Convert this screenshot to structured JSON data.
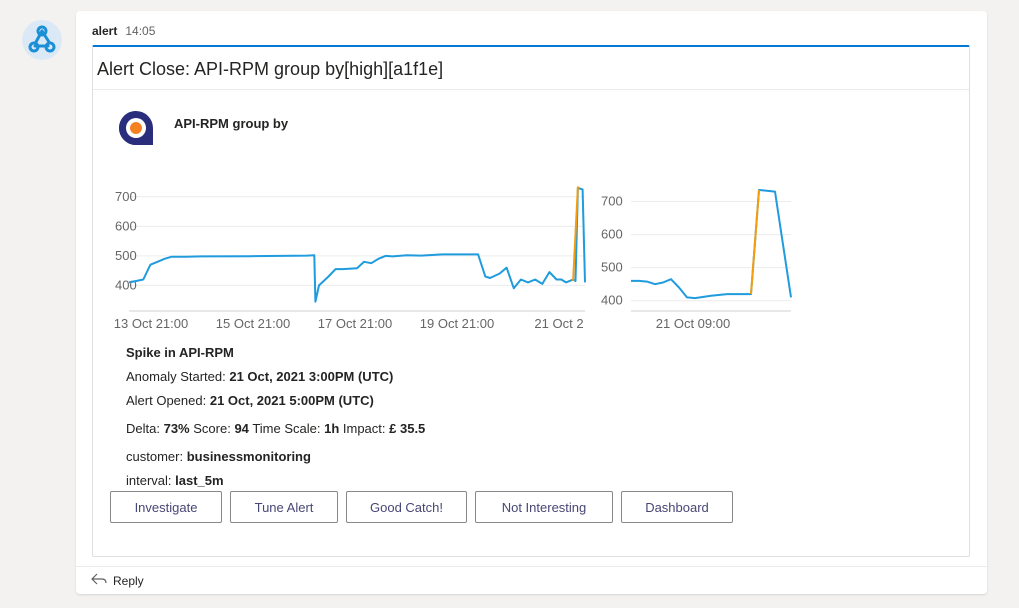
{
  "message": {
    "sender": "alert",
    "time": "14:05",
    "bot_icon": "webhook-icon"
  },
  "card": {
    "title": "Alert Close: API-RPM group by[high][a1f1e]",
    "logo_icon": "anodot-logo-icon",
    "subject": "API-RPM group by",
    "accent_color": "#0078d4"
  },
  "chart_data": [
    {
      "type": "line",
      "title": "",
      "y_ticks": [
        "700",
        "600",
        "500",
        "400"
      ],
      "x_ticks": [
        "13 Oct 21:00",
        "15 Oct 21:00",
        "17 Oct 21:00",
        "19 Oct 21:00",
        "21 Oct 2"
      ],
      "ylim": [
        320,
        740
      ],
      "series": [
        {
          "color": "#1f9bde",
          "x": [
            "2021-10-13T18:00",
            "2021-10-13T21:00",
            "2021-10-14T00:00",
            "2021-10-14T03:00",
            "2021-10-14T06:00",
            "2021-10-14T09:00",
            "2021-10-14T12:00",
            "2021-10-14T18:00",
            "2021-10-15T00:00",
            "2021-10-15T21:00",
            "2021-10-16T21:00",
            "2021-10-17T00:00",
            "2021-10-17T00:30",
            "2021-10-17T02:00",
            "2021-10-17T06:00",
            "2021-10-17T09:00",
            "2021-10-17T12:00",
            "2021-10-17T18:00",
            "2021-10-17T21:00",
            "2021-10-18T00:00",
            "2021-10-18T03:00",
            "2021-10-18T06:00",
            "2021-10-18T09:00",
            "2021-10-18T15:00",
            "2021-10-18T21:00",
            "2021-10-19T06:00",
            "2021-10-19T21:00",
            "2021-10-20T00:00",
            "2021-10-20T02:00",
            "2021-10-20T06:00",
            "2021-10-20T09:00",
            "2021-10-20T12:00",
            "2021-10-20T15:00",
            "2021-10-20T18:00",
            "2021-10-20T21:00",
            "2021-10-21T00:00",
            "2021-10-21T03:00",
            "2021-10-21T06:00",
            "2021-10-21T08:00",
            "2021-10-21T10:00",
            "2021-10-21T13:00",
            "2021-10-21T14:00",
            "2021-10-21T15:00",
            "2021-10-21T17:00",
            "2021-10-21T18:00"
          ],
          "values": [
            410,
            415,
            420,
            470,
            480,
            490,
            497,
            497,
            498,
            499,
            501,
            502,
            345,
            400,
            430,
            455,
            455,
            458,
            480,
            475,
            490,
            500,
            498,
            502,
            501,
            505,
            505,
            430,
            425,
            440,
            460,
            390,
            420,
            410,
            420,
            405,
            445,
            420,
            420,
            410,
            420,
            415,
            730,
            725,
            410
          ]
        },
        {
          "color": "#f59d0c",
          "x": [
            "2021-10-21T13:00",
            "2021-10-21T15:00"
          ],
          "values": [
            415,
            735
          ]
        }
      ]
    },
    {
      "type": "line",
      "title": "",
      "y_ticks": [
        "700",
        "600",
        "500",
        "400"
      ],
      "x_ticks": [
        "21 Oct 09:00"
      ],
      "ylim": [
        375,
        750
      ],
      "series": [
        {
          "color": "#1f9bde",
          "x": [
            "2021-10-21T07:00",
            "2021-10-21T07:30",
            "2021-10-21T08:00",
            "2021-10-21T08:30",
            "2021-10-21T09:00",
            "2021-10-21T09:30",
            "2021-10-21T10:00",
            "2021-10-21T10:30",
            "2021-10-21T11:00",
            "2021-10-21T12:00",
            "2021-10-21T13:00",
            "2021-10-21T14:00",
            "2021-10-21T14:30",
            "2021-10-21T15:00",
            "2021-10-21T16:00",
            "2021-10-21T17:00"
          ],
          "values": [
            460,
            460,
            458,
            450,
            455,
            465,
            440,
            410,
            408,
            415,
            420,
            420,
            420,
            735,
            730,
            410
          ]
        },
        {
          "color": "#f59d0c",
          "x": [
            "2021-10-21T14:30",
            "2021-10-21T15:00"
          ],
          "values": [
            420,
            735
          ]
        }
      ]
    }
  ],
  "details": {
    "heading": "Spike in API-RPM",
    "anomaly_started_label": "Anomaly Started:",
    "anomaly_started_value": "21 Oct, 2021 3:00PM (UTC)",
    "alert_opened_label": "Alert Opened:",
    "alert_opened_value": "21 Oct, 2021 5:00PM (UTC)",
    "delta_label": "Delta:",
    "delta_value": "73%",
    "score_label": "Score:",
    "score_value": "94",
    "timescale_label": "Time Scale:",
    "timescale_value": "1h",
    "impact_label": "Impact:",
    "impact_value": "£ 35.5",
    "customer_label": "customer:",
    "customer_value": "businessmonitoring",
    "interval_label": "interval:",
    "interval_value": "last_5m"
  },
  "actions": {
    "investigate": "Investigate",
    "tune_alert": "Tune Alert",
    "good_catch": "Good Catch!",
    "not_interesting": "Not Interesting",
    "dashboard": "Dashboard"
  },
  "reply": {
    "label": "Reply",
    "icon": "reply-arrow-icon"
  }
}
